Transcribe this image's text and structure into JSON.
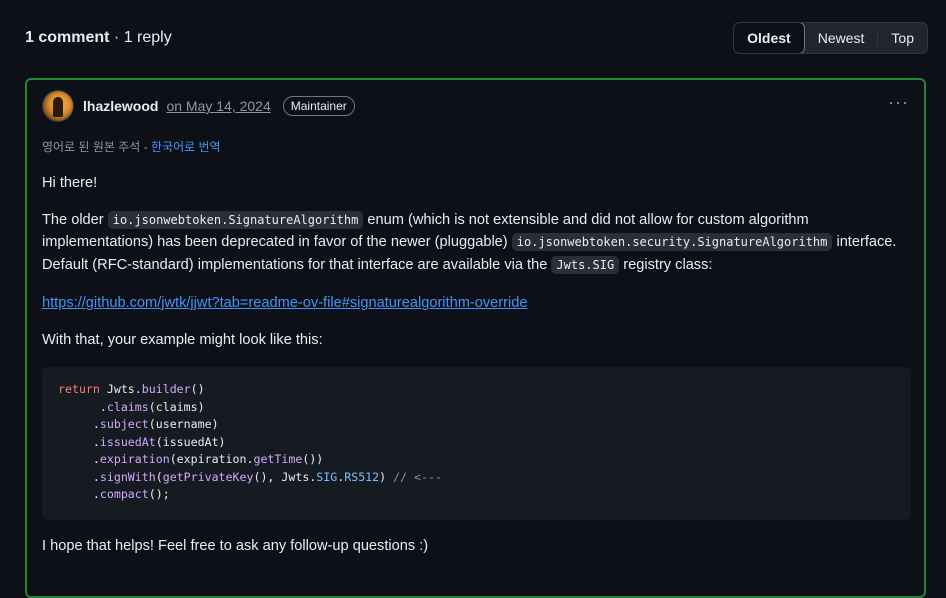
{
  "header": {
    "comment_count": "1 comment",
    "separator": "·",
    "reply_count": "1 reply",
    "sort": [
      "Oldest",
      "Newest",
      "Top"
    ]
  },
  "comment": {
    "author": "lhazlewood",
    "date": "on May 14, 2024",
    "badge": "Maintainer",
    "more": "···",
    "translate_text": "영어로 된 원본 주석 - ",
    "translate_link": "한국어로 번역",
    "greeting": "Hi there!",
    "p1_a": "The older ",
    "p1_code1": "io.jsonwebtoken.SignatureAlgorithm",
    "p1_b": " enum (which is not extensible and did not allow for custom algorithm implementations) has been deprecated in favor of the newer (pluggable) ",
    "p1_code2": "io.jsonwebtoken.security.SignatureAlgorithm",
    "p1_c": " interface. Default (RFC-standard) implementations for that interface are available via the ",
    "p1_code3": "Jwts.SIG",
    "p1_d": " registry class:",
    "link": "https://github.com/jwtk/jjwt?tab=readme-ov-file#signaturealgorithm-override",
    "p2": "With that, your example might look like this:",
    "code": {
      "l1_kw": "return",
      "l1_a": " Jwts.",
      "l1_fn": "builder",
      "l1_b": "()",
      "l2_a": "      .",
      "l2_fn": "claims",
      "l2_b": "(claims)",
      "l3_a": "     .",
      "l3_fn": "subject",
      "l3_b": "(username)",
      "l4_a": "     .",
      "l4_fn": "issuedAt",
      "l4_b": "(issuedAt)",
      "l5_a": "     .",
      "l5_fn": "expiration",
      "l5_b": "(expiration.",
      "l5_fn2": "getTime",
      "l5_c": "())",
      "l6_a": "     .",
      "l6_fn": "signWith",
      "l6_b": "(",
      "l6_fn2": "getPrivateKey",
      "l6_c": "(), Jwts.",
      "l6_cst1": "SIG",
      "l6_d": ".",
      "l6_cst2": "RS512",
      "l6_e": ") ",
      "l6_cm": "// <---",
      "l7_a": "     .",
      "l7_fn": "compact",
      "l7_b": "();"
    },
    "p3": "I hope that helps! Feel free to ask any follow-up questions :)"
  }
}
